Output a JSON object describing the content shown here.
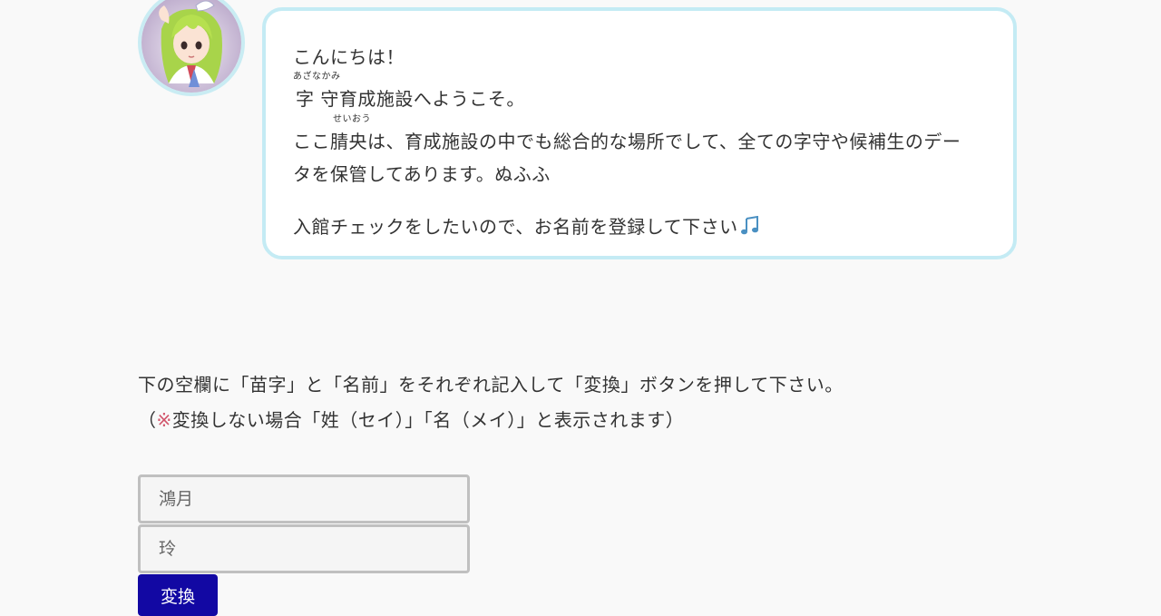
{
  "greeting": {
    "line1": "こんにちは！",
    "line2_ruby": "あざなかみ",
    "line2": "字 守育成施設へようこそ。",
    "line3_ruby": "せいおう",
    "line3": "ここ腈央は、育成施設の中でも総合的な場所でして、全ての字守や候補生のデー",
    "line4": "タを保管してあります。ぬふふ",
    "line5": "入館チェックをしたいので、お名前を登録して下さい"
  },
  "instructions": {
    "line1": "下の空欄に「苗字」と「名前」をそれぞれ記入して「変換」ボタンを押して下さい。",
    "line2_open": "（",
    "line2_mark": "※",
    "line2_rest": "変換しない場合「姓（セイ）」「名（メイ）」と表示されます）"
  },
  "form": {
    "surname_placeholder": "鴻月",
    "name_placeholder": "玲",
    "convert_label": "変換"
  },
  "colors": {
    "bubble_border": "#c4ebf4",
    "avatar_border": "#c9ecf3",
    "button_bg": "#1208a3",
    "note_mark": "#d2566c",
    "music_note": "#4a90c2"
  },
  "icons": {
    "avatar": "character-avatar-icon",
    "music": "music-note-icon"
  }
}
